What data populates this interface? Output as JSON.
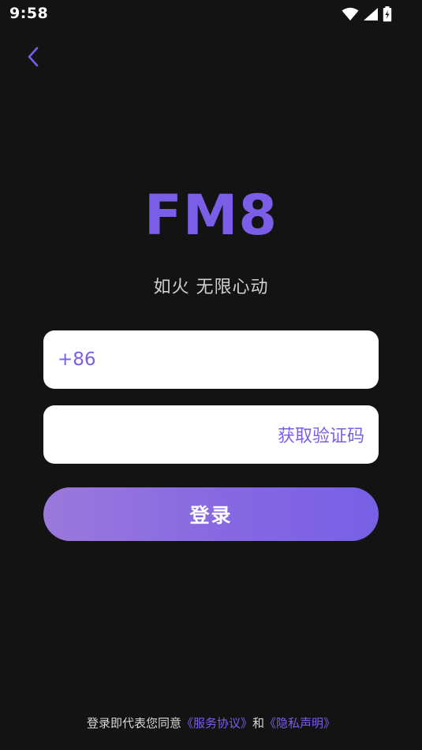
{
  "status_bar": {
    "time": "9:58",
    "icons": [
      "wifi-icon",
      "cell-signal-icon",
      "battery-charging-icon"
    ]
  },
  "nav": {
    "back_icon": "chevron-left-icon"
  },
  "branding": {
    "logo": "FM8",
    "slogan": "如火 无限心动"
  },
  "form": {
    "phone_prefix": "+86",
    "phone_value": "",
    "phone_placeholder": "",
    "code_value": "",
    "code_placeholder": "",
    "get_code_label": "获取验证码",
    "login_label": "登录"
  },
  "agreement": {
    "prefix": "登录即代表您同意",
    "service_link": "《服务协议》",
    "conjunction": "和",
    "privacy_link": "《隐私声明》"
  },
  "colors": {
    "background": "#141314",
    "accent": "#7b5ee8",
    "button_gradient_start": "#9a79dc",
    "button_gradient_end": "#7760e6"
  }
}
